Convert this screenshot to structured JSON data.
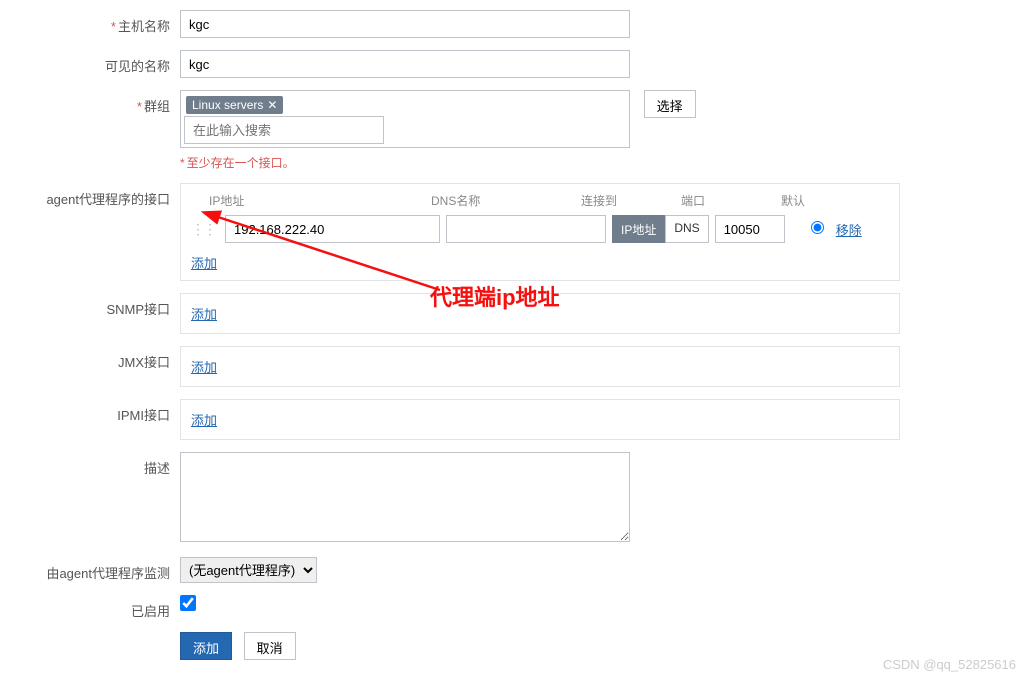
{
  "labels": {
    "hostname": "主机名称",
    "visible_name": "可见的名称",
    "groups": "群组",
    "select_btn": "选择",
    "group_search_ph": "在此输入搜索",
    "interface_hint": "至少存在一个接口。",
    "agent_iface": "agent代理程序的接口",
    "snmp_iface": "SNMP接口",
    "jmx_iface": "JMX接口",
    "ipmi_iface": "IPMI接口",
    "description": "描述",
    "monitored_by": "由agent代理程序监测",
    "enabled": "已启用",
    "add_btn": "添加",
    "cancel_btn": "取消",
    "add_link": "添加",
    "remove_link": "移除"
  },
  "iface_headers": {
    "ip": "IP地址",
    "dns": "DNS名称",
    "connect": "连接到",
    "port": "端口",
    "default": "默认"
  },
  "values": {
    "hostname": "kgc",
    "visible_name": "kgc",
    "group_tag": "Linux servers",
    "agent_ip": "192.168.222.40",
    "agent_dns": "",
    "agent_port": "10050",
    "conn_ip": "IP地址",
    "conn_dns": "DNS",
    "proxy_select": "(无agent代理程序)"
  },
  "annotation": "代理端ip地址",
  "watermark": "CSDN @qq_52825616"
}
